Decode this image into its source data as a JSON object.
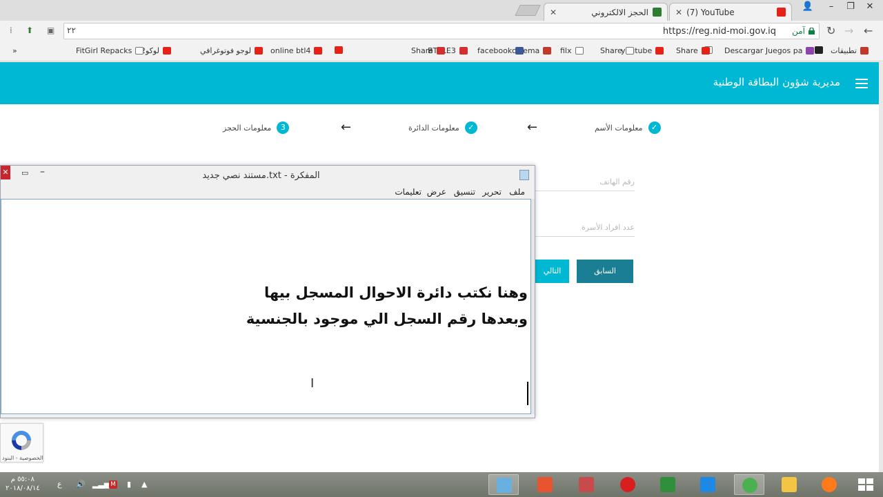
{
  "browser": {
    "tabs": [
      {
        "title": "(7) YouTube",
        "close": "✕"
      },
      {
        "title": "الحجز الالكتروني",
        "close": "✕"
      }
    ],
    "window_controls": {
      "minimize": "–",
      "maximize": "❐",
      "close": "✕",
      "user": "👤"
    },
    "url": "https://reg.nid-moi.gov.iq",
    "security_label": "آمن",
    "zoom_label": "٢٢",
    "bookmarks_overflow": "»",
    "bookmarks": [
      {
        "label": "تطبيقات",
        "icon": "apps-grid-icon",
        "color": "#c0392b"
      },
      {
        "label": "",
        "icon": "dt-icon",
        "color": "#222222"
      },
      {
        "label": "Descargar Juegos pa",
        "icon": "game-icon",
        "color": "#8e44ad"
      },
      {
        "label": "",
        "icon": "page-icon",
        "color": "#ffffff"
      },
      {
        "label": "Share",
        "icon": "youtube-icon",
        "color": "#e62117"
      },
      {
        "label": "youtube",
        "icon": "youtube-icon",
        "color": "#e62117"
      },
      {
        "label": "Share",
        "icon": "page-icon",
        "color": "#ffffff"
      },
      {
        "label": "filx",
        "icon": "page-icon",
        "color": "#ffffff"
      },
      {
        "label": "cinema",
        "icon": "cinema-icon",
        "color": "#c0392b"
      },
      {
        "label": "facebook",
        "icon": "facebook-icon",
        "color": "#3b5998"
      },
      {
        "label": "BTTLE3",
        "icon": "bttle-icon",
        "color": "#d32f2f"
      },
      {
        "label": "Share",
        "icon": "bttle-icon",
        "color": "#d32f2f"
      },
      {
        "label": "",
        "icon": "youtube-icon",
        "color": "#e62117"
      },
      {
        "label": "online btl4",
        "icon": "youtube-icon",
        "color": "#e62117"
      },
      {
        "label": "لوجو فوتوغرافي",
        "icon": "youtube-icon",
        "color": "#e62117"
      },
      {
        "label": "لوكو2",
        "icon": "youtube-icon",
        "color": "#e62117"
      },
      {
        "label": "FitGirl Repacks",
        "icon": "page-icon",
        "color": "#ffffff"
      }
    ]
  },
  "page": {
    "title": "مديرية شؤون البطاقة الوطنية",
    "steps": [
      {
        "label": "معلومات الأسم",
        "icon": "✓"
      },
      {
        "label": "معلومات الدائرة",
        "icon": "✓"
      },
      {
        "label": "معلومات الحجز",
        "icon": "3"
      }
    ],
    "arrow": "←",
    "fields": {
      "phone_placeholder": "رقم الهاتف",
      "family_placeholder": "عدد افراد الأسرة"
    },
    "buttons": {
      "previous": "السابق",
      "next": "التالي"
    },
    "recaptcha_text": "الخصوصية - البنود"
  },
  "notepad": {
    "title": "مستند نصي جديد.txt - المفكرة",
    "controls": {
      "close": "✕",
      "maximize": "▭",
      "minimize": "–"
    },
    "menu": [
      "ملف",
      "تحرير",
      "تنسيق",
      "عرض",
      "تعليمات"
    ],
    "lines": [
      "وهنا نكتب دائرة الاحوال المسجل بيها",
      "وبعدها رقم السجل الي موجود بالجنسية"
    ],
    "ibeam": "I"
  },
  "taskbar": {
    "time": "٥٥:٠٨ م",
    "date": "٢٠١٨/٠٨/١٤",
    "lang": "ع",
    "apps": [
      {
        "name": "notepad",
        "color": "#6ab0de",
        "active": true
      },
      {
        "name": "camtasia",
        "color": "#e8542f",
        "active": false
      },
      {
        "name": "snipping",
        "color": "#c94a4a",
        "active": false
      },
      {
        "name": "opera",
        "color": "#d81e1e",
        "active": false
      },
      {
        "name": "downloader",
        "color": "#2f8f3a",
        "active": false
      },
      {
        "name": "internet-explorer",
        "color": "#1e88e5",
        "active": false
      },
      {
        "name": "chrome",
        "color": "#4caf50",
        "active": true
      },
      {
        "name": "file-explorer",
        "color": "#f4c542",
        "active": false
      },
      {
        "name": "firefox",
        "color": "#ff7a1a",
        "active": false
      }
    ]
  }
}
